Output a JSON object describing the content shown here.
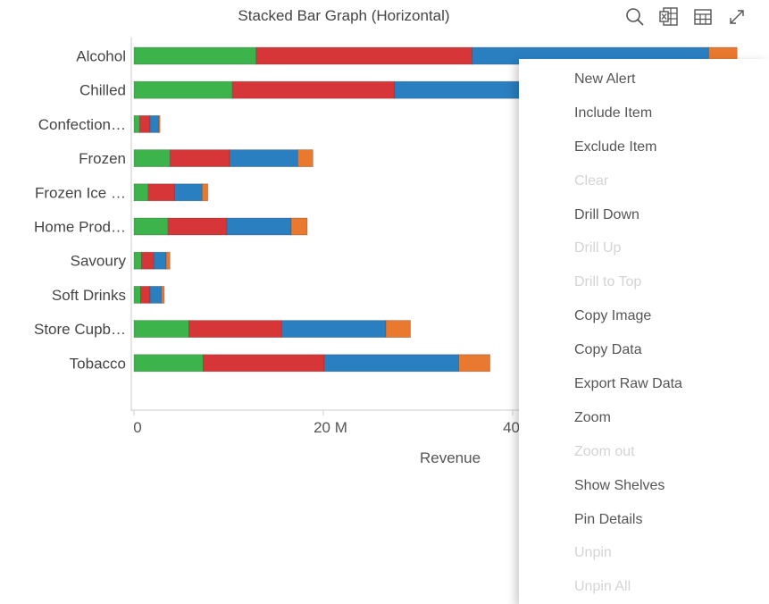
{
  "toolbar": {
    "icons": [
      "search-icon",
      "excel-export-icon",
      "table-view-icon",
      "expand-icon"
    ]
  },
  "colors": {
    "series": [
      "#3cb44b",
      "#d63638",
      "#2a7fc1",
      "#e8792f"
    ],
    "axis": "#cccccc",
    "grid": "#e0e0e0"
  },
  "chart_data": {
    "type": "bar",
    "orientation": "horizontal",
    "stacked": true,
    "title": "Stacked Bar Graph (Horizontal)",
    "xlabel": "Revenue",
    "ylabel": "",
    "xlim": [
      0,
      60
    ],
    "xunit": "M",
    "xticks": [
      {
        "value": 0,
        "label": "0"
      },
      {
        "value": 20,
        "label": "20 M"
      },
      {
        "value": 40,
        "label": "40 M"
      }
    ],
    "grid": false,
    "legend": "none",
    "categories": [
      "Alcohol",
      "Chilled",
      "Confection…",
      "Frozen",
      "Frozen Ice …",
      "Home Prod…",
      "Savoury",
      "Soft Drinks",
      "Store Cupb…",
      "Tobacco"
    ],
    "series": [
      {
        "values": [
          12.9,
          10.4,
          0.6,
          3.8,
          1.5,
          3.6,
          0.8,
          0.7,
          5.8,
          7.3
        ]
      },
      {
        "values": [
          22.8,
          17.1,
          1.1,
          6.3,
          2.8,
          6.2,
          1.3,
          1.0,
          9.8,
          12.8
        ]
      },
      {
        "values": [
          25.0,
          16.0,
          0.9,
          7.2,
          2.9,
          6.8,
          1.3,
          1.2,
          11.0,
          14.2
        ]
      },
      {
        "values": [
          3.0,
          0,
          0.15,
          1.6,
          0.6,
          1.7,
          0.4,
          0.3,
          2.6,
          3.3
        ]
      }
    ]
  },
  "context_menu": {
    "items": [
      {
        "label": "New Alert",
        "enabled": true
      },
      {
        "label": "Include Item",
        "enabled": true
      },
      {
        "label": "Exclude Item",
        "enabled": true
      },
      {
        "label": "Clear",
        "enabled": false
      },
      {
        "label": "Drill Down",
        "enabled": true
      },
      {
        "label": "Drill Up",
        "enabled": false
      },
      {
        "label": "Drill to Top",
        "enabled": false
      },
      {
        "label": "Copy Image",
        "enabled": true
      },
      {
        "label": "Copy Data",
        "enabled": true
      },
      {
        "label": "Export Raw Data",
        "enabled": true
      },
      {
        "label": "Zoom",
        "enabled": true
      },
      {
        "label": "Zoom out",
        "enabled": false
      },
      {
        "label": "Show Shelves",
        "enabled": true
      },
      {
        "label": "Pin Details",
        "enabled": true
      },
      {
        "label": "Unpin",
        "enabled": false
      },
      {
        "label": "Unpin All",
        "enabled": false
      }
    ]
  }
}
